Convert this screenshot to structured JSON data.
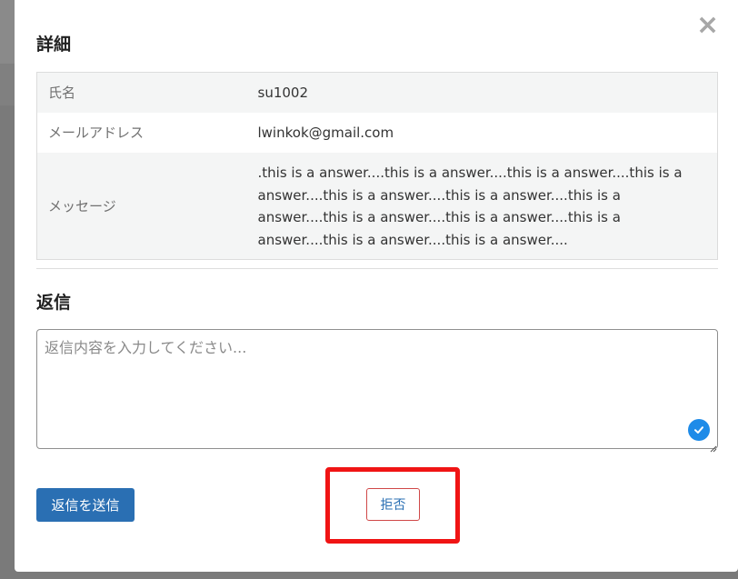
{
  "modal": {
    "close_label": "×",
    "details_title": "詳細",
    "reply_title": "返信"
  },
  "details": {
    "rows": [
      {
        "label": "氏名",
        "value": "su1002"
      },
      {
        "label": "メールアドレス",
        "value": "lwinkok@gmail.com"
      },
      {
        "label": "メッセージ",
        "value": ".this is a answer....this is a answer....this is a answer....this is a answer....this is a answer....this is a answer....this is a answer....this is a answer....this is a answer....this is a answer....this is a answer....this is a answer...."
      }
    ]
  },
  "reply": {
    "placeholder": "返信内容を入力してください...",
    "value": ""
  },
  "actions": {
    "send_label": "返信を送信",
    "reject_label": "拒否"
  },
  "colors": {
    "primary": "#2a6fb3",
    "highlight": "#f01414",
    "check_badge": "#1e8be8",
    "overlay": "#7a7a7a"
  },
  "icons": {
    "close": "close-icon",
    "check": "check-circle-icon",
    "grip": "resize-grip-icon"
  }
}
